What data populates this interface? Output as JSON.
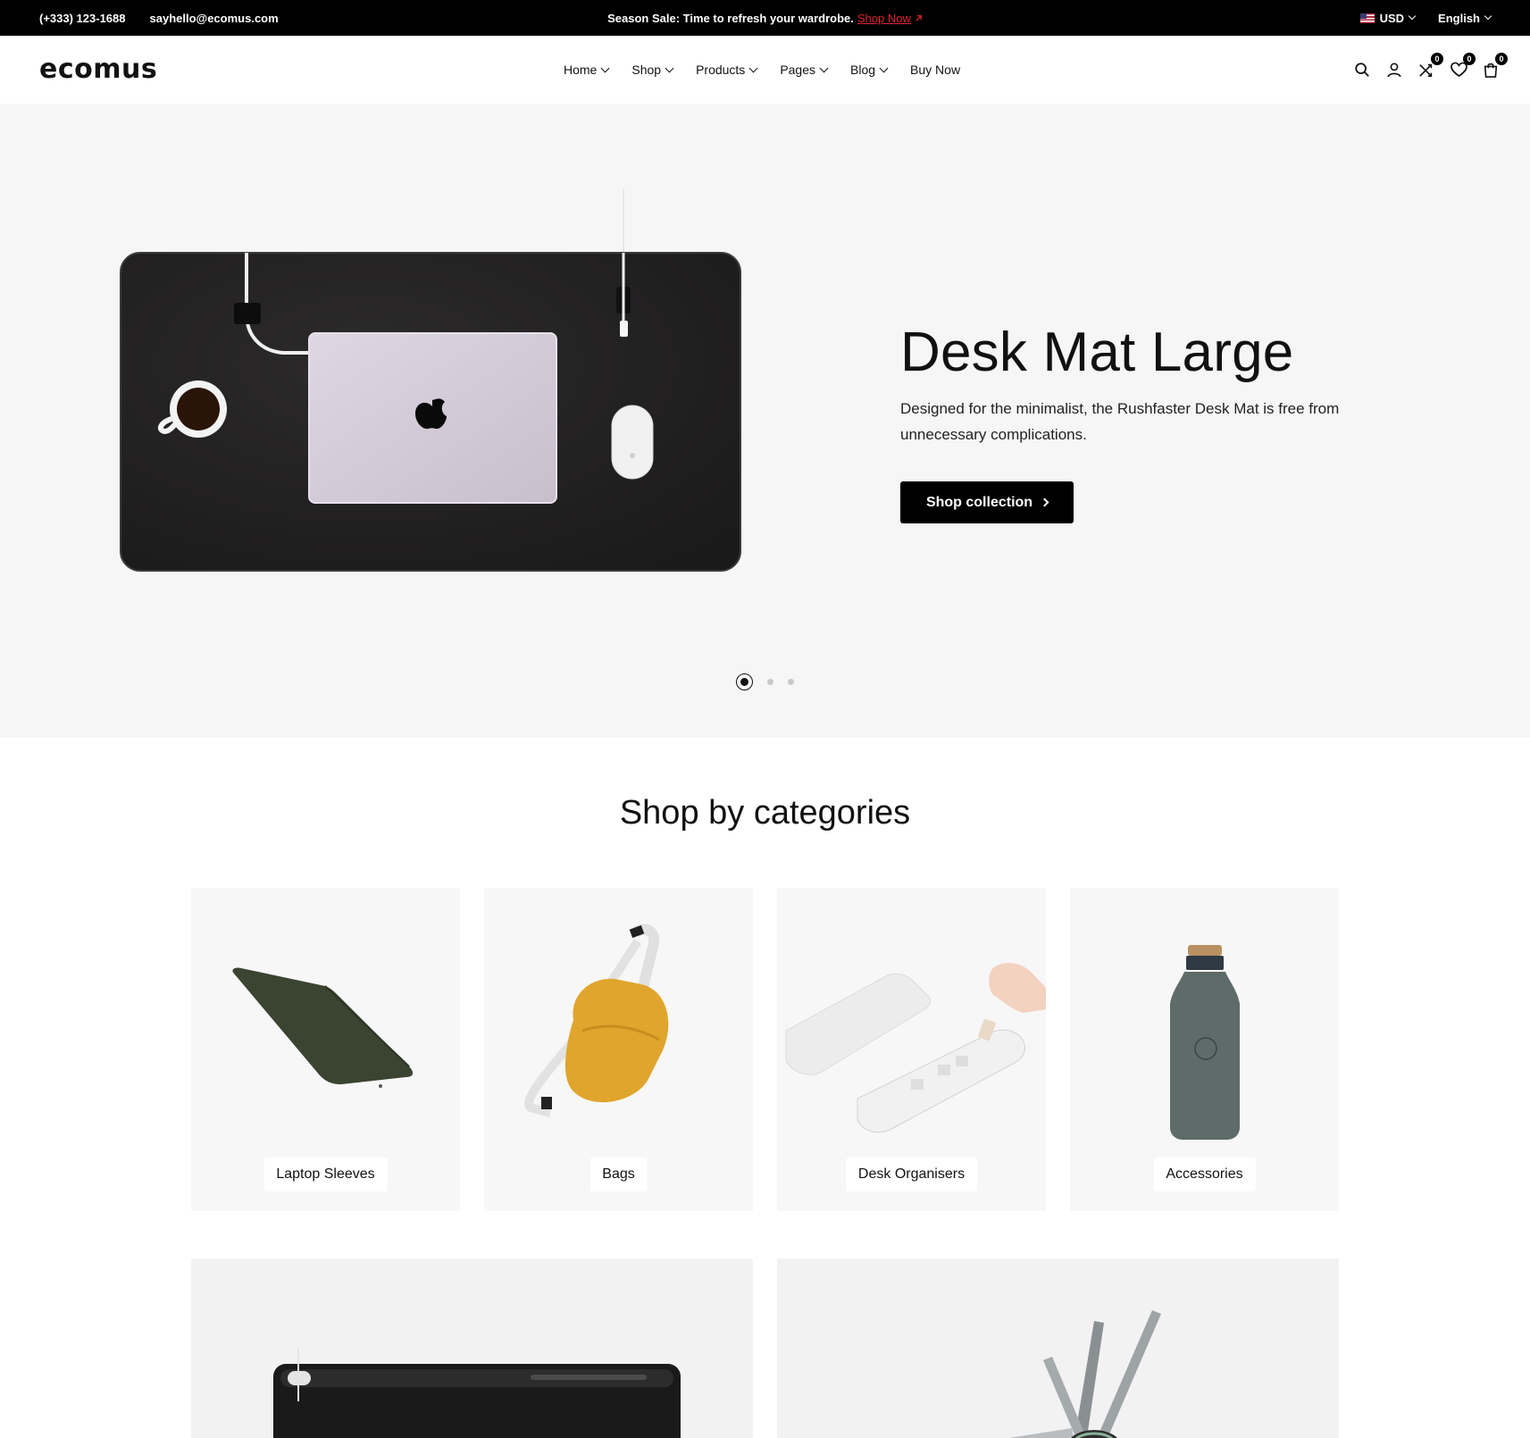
{
  "topbar": {
    "phone": "(+333) 123-1688",
    "email": "sayhello@ecomus.com",
    "promo_text": "Season Sale: Time to refresh your wardrobe.",
    "promo_link": "Shop Now",
    "currency": "USD",
    "language": "English"
  },
  "header": {
    "logo": "ecomus",
    "nav": [
      "Home",
      "Shop",
      "Products",
      "Pages",
      "Blog",
      "Buy Now"
    ],
    "compare_count": "0",
    "wishlist_count": "0",
    "cart_count": "0"
  },
  "hero": {
    "title": "Desk Mat Large",
    "description": "Designed for the minimalist, the Rushfaster Desk Mat is free from unnecessary complications.",
    "button": "Shop collection",
    "slides": 3,
    "active_slide": 1
  },
  "categories": {
    "title": "Shop by categories",
    "items": [
      {
        "label": "Laptop Sleeves"
      },
      {
        "label": "Bags"
      },
      {
        "label": "Desk Organisers"
      },
      {
        "label": "Accessories"
      }
    ]
  }
}
